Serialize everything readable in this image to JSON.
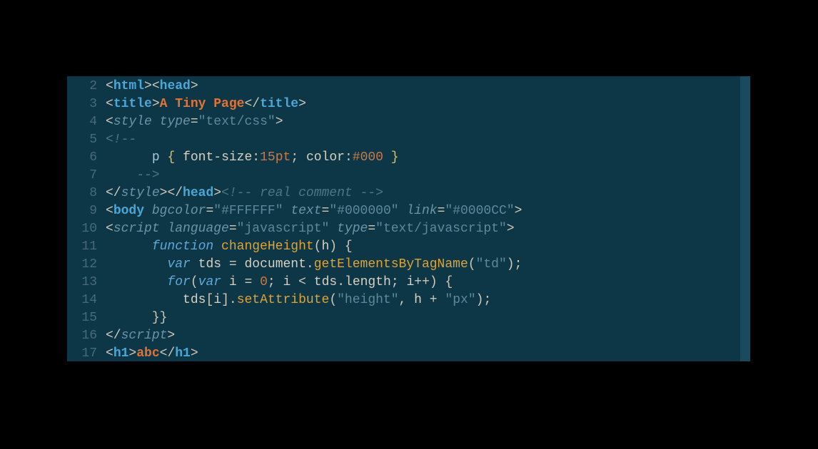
{
  "editor": {
    "lineNumbers": [
      "2",
      "3",
      "4",
      "5",
      "6",
      "7",
      "8",
      "9",
      "10",
      "11",
      "12",
      "13",
      "14",
      "15",
      "16",
      "17"
    ],
    "lines": [
      [
        {
          "t": "<",
          "c": "punct"
        },
        {
          "t": "html",
          "c": "tag"
        },
        {
          "t": ">",
          "c": "punct"
        },
        {
          "t": "<",
          "c": "punct"
        },
        {
          "t": "head",
          "c": "tag"
        },
        {
          "t": ">",
          "c": "punct"
        }
      ],
      [
        {
          "t": "<",
          "c": "punct"
        },
        {
          "t": "title",
          "c": "tag"
        },
        {
          "t": ">",
          "c": "punct"
        },
        {
          "t": "A Tiny Page",
          "c": "txt-o"
        },
        {
          "t": "</",
          "c": "punct"
        },
        {
          "t": "title",
          "c": "tag"
        },
        {
          "t": ">",
          "c": "punct"
        }
      ],
      [
        {
          "t": "<",
          "c": "punct"
        },
        {
          "t": "style",
          "c": "attr"
        },
        {
          "t": " ",
          "c": ""
        },
        {
          "t": "type",
          "c": "attr"
        },
        {
          "t": "=",
          "c": "op"
        },
        {
          "t": "\"text/css\"",
          "c": "str"
        },
        {
          "t": ">",
          "c": "punct"
        }
      ],
      [
        {
          "t": "<!--",
          "c": "cmt"
        }
      ],
      [
        {
          "t": "      ",
          "c": ""
        },
        {
          "t": "p",
          "c": "sel"
        },
        {
          "t": " ",
          "c": ""
        },
        {
          "t": "{",
          "c": "brace-y"
        },
        {
          "t": " ",
          "c": ""
        },
        {
          "t": "font-size",
          "c": "css-prop"
        },
        {
          "t": ":",
          "c": "punct"
        },
        {
          "t": "15pt",
          "c": "css-val"
        },
        {
          "t": ";",
          "c": "punct"
        },
        {
          "t": " ",
          "c": ""
        },
        {
          "t": "color",
          "c": "css-prop"
        },
        {
          "t": ":",
          "c": "punct"
        },
        {
          "t": "#000",
          "c": "css-val"
        },
        {
          "t": " ",
          "c": ""
        },
        {
          "t": "}",
          "c": "brace-y"
        }
      ],
      [
        {
          "t": "    -->",
          "c": "cmt"
        }
      ],
      [
        {
          "t": "</",
          "c": "punct"
        },
        {
          "t": "style",
          "c": "attr"
        },
        {
          "t": ">",
          "c": "punct"
        },
        {
          "t": "</",
          "c": "punct"
        },
        {
          "t": "head",
          "c": "tag"
        },
        {
          "t": ">",
          "c": "punct"
        },
        {
          "t": "<!-- real comment -->",
          "c": "cmt"
        }
      ],
      [
        {
          "t": "<",
          "c": "punct"
        },
        {
          "t": "body",
          "c": "tag"
        },
        {
          "t": " ",
          "c": ""
        },
        {
          "t": "bgcolor",
          "c": "attr"
        },
        {
          "t": "=",
          "c": "op"
        },
        {
          "t": "\"#FFFFFF\"",
          "c": "str"
        },
        {
          "t": " ",
          "c": ""
        },
        {
          "t": "text",
          "c": "attr"
        },
        {
          "t": "=",
          "c": "op"
        },
        {
          "t": "\"#000000\"",
          "c": "str"
        },
        {
          "t": " ",
          "c": ""
        },
        {
          "t": "link",
          "c": "attr"
        },
        {
          "t": "=",
          "c": "op"
        },
        {
          "t": "\"#0000CC\"",
          "c": "str"
        },
        {
          "t": ">",
          "c": "punct"
        }
      ],
      [
        {
          "t": "<",
          "c": "punct"
        },
        {
          "t": "script",
          "c": "attr"
        },
        {
          "t": " ",
          "c": ""
        },
        {
          "t": "language",
          "c": "attr"
        },
        {
          "t": "=",
          "c": "op"
        },
        {
          "t": "\"javascript\"",
          "c": "str"
        },
        {
          "t": " ",
          "c": ""
        },
        {
          "t": "type",
          "c": "attr"
        },
        {
          "t": "=",
          "c": "op"
        },
        {
          "t": "\"text/javascript\"",
          "c": "str"
        },
        {
          "t": ">",
          "c": "punct"
        }
      ],
      [
        {
          "t": "      ",
          "c": ""
        },
        {
          "t": "function",
          "c": "kw"
        },
        {
          "t": " ",
          "c": ""
        },
        {
          "t": "changeHeight",
          "c": "fn"
        },
        {
          "t": "(",
          "c": "punct"
        },
        {
          "t": "h",
          "c": "obj"
        },
        {
          "t": ")",
          "c": "punct"
        },
        {
          "t": " ",
          "c": ""
        },
        {
          "t": "{",
          "c": "punct"
        }
      ],
      [
        {
          "t": "        ",
          "c": ""
        },
        {
          "t": "var",
          "c": "kw"
        },
        {
          "t": " ",
          "c": ""
        },
        {
          "t": "tds",
          "c": "obj"
        },
        {
          "t": " ",
          "c": ""
        },
        {
          "t": "=",
          "c": "op"
        },
        {
          "t": " ",
          "c": ""
        },
        {
          "t": "document",
          "c": "obj"
        },
        {
          "t": ".",
          "c": "punct"
        },
        {
          "t": "getElementsByTagName",
          "c": "fn"
        },
        {
          "t": "(",
          "c": "punct"
        },
        {
          "t": "\"td\"",
          "c": "str"
        },
        {
          "t": ")",
          "c": "punct"
        },
        {
          "t": ";",
          "c": "punct"
        }
      ],
      [
        {
          "t": "        ",
          "c": ""
        },
        {
          "t": "for",
          "c": "kw"
        },
        {
          "t": "(",
          "c": "punct"
        },
        {
          "t": "var",
          "c": "kw"
        },
        {
          "t": " ",
          "c": ""
        },
        {
          "t": "i",
          "c": "obj"
        },
        {
          "t": " ",
          "c": ""
        },
        {
          "t": "=",
          "c": "op"
        },
        {
          "t": " ",
          "c": ""
        },
        {
          "t": "0",
          "c": "num"
        },
        {
          "t": ";",
          "c": "punct"
        },
        {
          "t": " ",
          "c": ""
        },
        {
          "t": "i",
          "c": "obj"
        },
        {
          "t": " ",
          "c": ""
        },
        {
          "t": "<",
          "c": "op"
        },
        {
          "t": " ",
          "c": ""
        },
        {
          "t": "tds",
          "c": "obj"
        },
        {
          "t": ".",
          "c": "punct"
        },
        {
          "t": "length",
          "c": "obj"
        },
        {
          "t": ";",
          "c": "punct"
        },
        {
          "t": " ",
          "c": ""
        },
        {
          "t": "i",
          "c": "obj"
        },
        {
          "t": "++",
          "c": "op"
        },
        {
          "t": ")",
          "c": "punct"
        },
        {
          "t": " ",
          "c": ""
        },
        {
          "t": "{",
          "c": "punct"
        }
      ],
      [
        {
          "t": "          ",
          "c": ""
        },
        {
          "t": "tds",
          "c": "obj"
        },
        {
          "t": "[",
          "c": "punct"
        },
        {
          "t": "i",
          "c": "obj"
        },
        {
          "t": "]",
          "c": "punct"
        },
        {
          "t": ".",
          "c": "punct"
        },
        {
          "t": "setAttribute",
          "c": "fn"
        },
        {
          "t": "(",
          "c": "punct"
        },
        {
          "t": "\"height\"",
          "c": "str"
        },
        {
          "t": ",",
          "c": "punct"
        },
        {
          "t": " ",
          "c": ""
        },
        {
          "t": "h",
          "c": "obj"
        },
        {
          "t": " ",
          "c": ""
        },
        {
          "t": "+",
          "c": "op"
        },
        {
          "t": " ",
          "c": ""
        },
        {
          "t": "\"px\"",
          "c": "str"
        },
        {
          "t": ")",
          "c": "punct"
        },
        {
          "t": ";",
          "c": "punct"
        }
      ],
      [
        {
          "t": "      ",
          "c": ""
        },
        {
          "t": "}}",
          "c": "punct"
        }
      ],
      [
        {
          "t": "</",
          "c": "punct"
        },
        {
          "t": "script",
          "c": "attr"
        },
        {
          "t": ">",
          "c": "punct"
        }
      ],
      [
        {
          "t": "<",
          "c": "punct"
        },
        {
          "t": "h1",
          "c": "tag"
        },
        {
          "t": ">",
          "c": "punct"
        },
        {
          "t": "abc",
          "c": "txt-o"
        },
        {
          "t": "</",
          "c": "punct"
        },
        {
          "t": "h1",
          "c": "tag"
        },
        {
          "t": ">",
          "c": "punct"
        }
      ]
    ]
  }
}
